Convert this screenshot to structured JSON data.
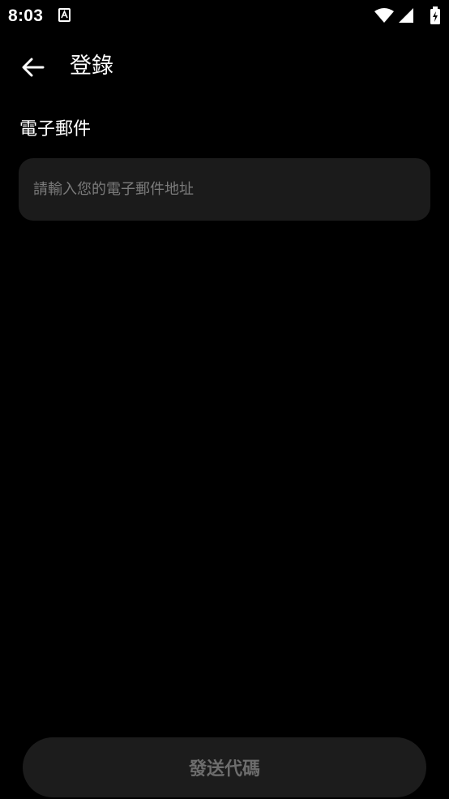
{
  "status_bar": {
    "time": "8:03",
    "app_icon": "font-a-icon",
    "wifi_icon": "wifi-icon",
    "signal_icon": "cellular-signal-icon",
    "battery_icon": "battery-charging-icon"
  },
  "app_bar": {
    "back_icon": "arrow-back-icon",
    "title": "登錄"
  },
  "form": {
    "email_label": "電子郵件",
    "email_placeholder": "請輸入您的電子郵件地址",
    "email_value": ""
  },
  "actions": {
    "send_code_label": "發送代碼"
  },
  "colors": {
    "background": "#000000",
    "field_background": "#1b1b1b",
    "placeholder_text": "#7b7b7b",
    "button_background": "#1c1c1c",
    "button_text_disabled": "#6d6d6d"
  }
}
